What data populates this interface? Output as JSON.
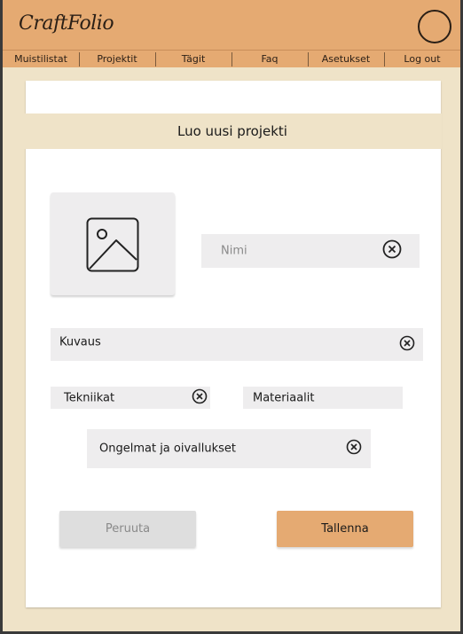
{
  "app": {
    "logo_text": "CraftFolio",
    "accent_color": "#e5aa72",
    "background_color": "#efe3c8"
  },
  "header": {
    "avatar_icon": "user-avatar-circle"
  },
  "nav": {
    "items": [
      {
        "label": "Muistilistat"
      },
      {
        "label": "Projektit"
      },
      {
        "label": "Tägit"
      },
      {
        "label": "Faq"
      },
      {
        "label": "Asetukset"
      },
      {
        "label": "Log out"
      }
    ]
  },
  "form": {
    "title": "Luo uusi projekti",
    "image_icon": "image-placeholder-icon",
    "fields": {
      "nimi": {
        "placeholder": "Nimi",
        "clear_icon": "clear-circle-x-icon"
      },
      "kuvaus": {
        "placeholder": "Kuvaus",
        "clear_icon": "clear-circle-x-icon"
      },
      "tekniikat": {
        "placeholder": "Tekniikat",
        "clear_icon": "clear-circle-x-icon"
      },
      "materiaalit": {
        "placeholder": "Materiaalit"
      },
      "ongelmat": {
        "placeholder": "Ongelmat ja oivallukset",
        "clear_icon": "clear-circle-x-icon"
      }
    },
    "buttons": {
      "cancel_label": "Peruuta",
      "save_label": "Tallenna"
    }
  }
}
